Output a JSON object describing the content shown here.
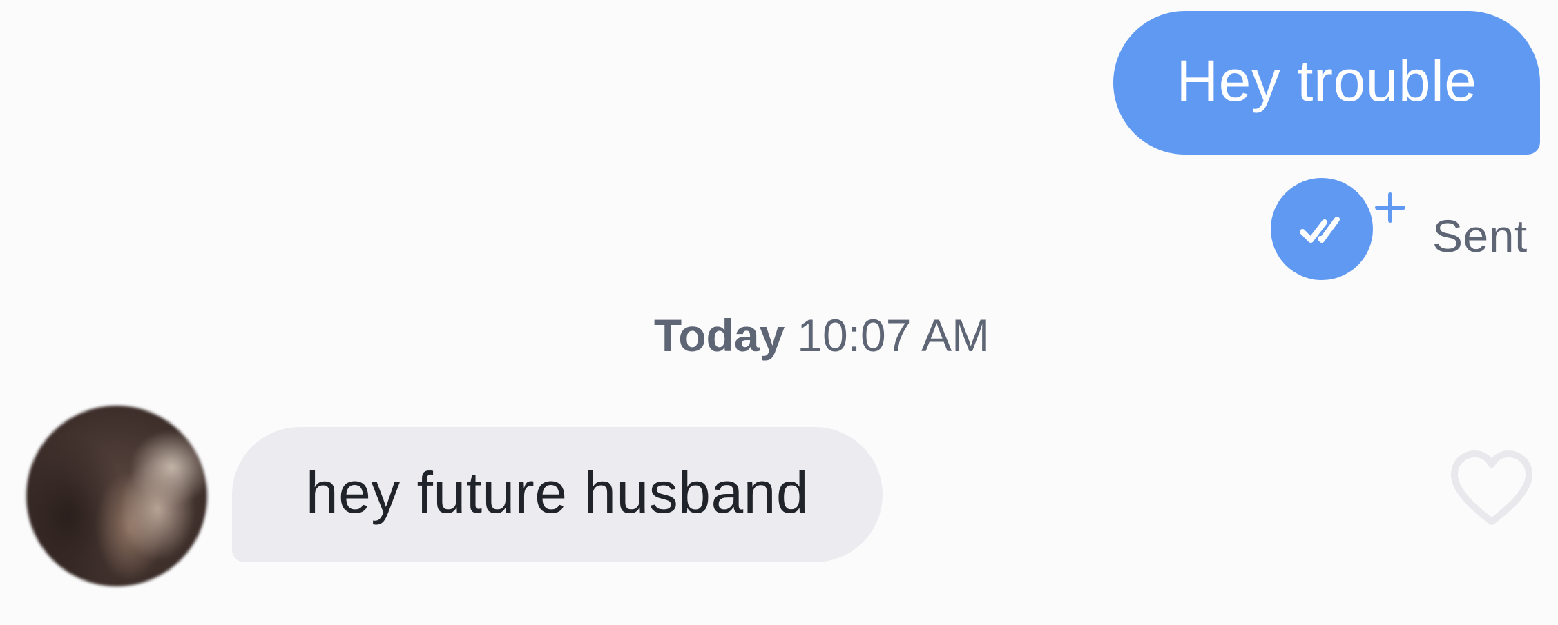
{
  "messages": {
    "outgoing": {
      "text": "Hey trouble",
      "status": "Sent"
    },
    "divider": {
      "day": "Today",
      "time": "10:07 AM"
    },
    "incoming": {
      "text": "hey future husband"
    }
  },
  "icons": {
    "receipt": "double-check-icon",
    "plus": "plus-icon",
    "like": "heart-icon"
  },
  "colors": {
    "outgoing_bubble": "#5f99f2",
    "incoming_bubble": "#ececf0",
    "meta_text": "#5e6574",
    "heart_outline": "#e9e9ed"
  }
}
